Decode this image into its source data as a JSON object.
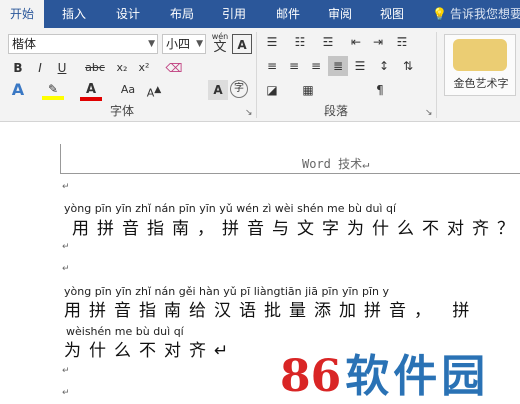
{
  "tabs": [
    "开始",
    "插入",
    "设计",
    "布局",
    "引用",
    "邮件",
    "审阅",
    "视图"
  ],
  "tell_me": "告诉我您想要",
  "font": {
    "name": "楷体",
    "size": "小四",
    "wen_glyph": "wén",
    "a_glyph": "A"
  },
  "format_buttons": {
    "bold": "B",
    "italic": "I",
    "underline": "U",
    "strike": "abc",
    "sub": "x₂",
    "sup": "x²"
  },
  "group_labels": {
    "font": "字体",
    "paragraph": "段落"
  },
  "wordart_label": "金色艺术字",
  "header_text": "Word 技术↵",
  "lines": [
    {
      "pinyin": "yòng pīn yīn zhǐ nán   pīn yīn yǔ wén zì wèi shén me bù duì qí",
      "hanzi": "用拼音指南，拼音与文字为什么不对齐？↵"
    },
    {
      "pinyin": "yòng pīn yīn zhǐ nán gěi hàn yǔ  pī liàngtiān jiā pīn yīn       pīn y",
      "hanzi": "用拼音指南给汉语批量添加拼音，  拼"
    },
    {
      "pinyin": "wèishén me  bù  duì  qí",
      "hanzi": "为什么不对齐↵"
    }
  ],
  "watermark": "86软件园",
  "colors": {
    "tabbar": "#2b579a",
    "highlight": "#ffff00",
    "font_color": "#e00000",
    "wm_blue": "#2a72b5",
    "wm_red": "#d92525"
  }
}
